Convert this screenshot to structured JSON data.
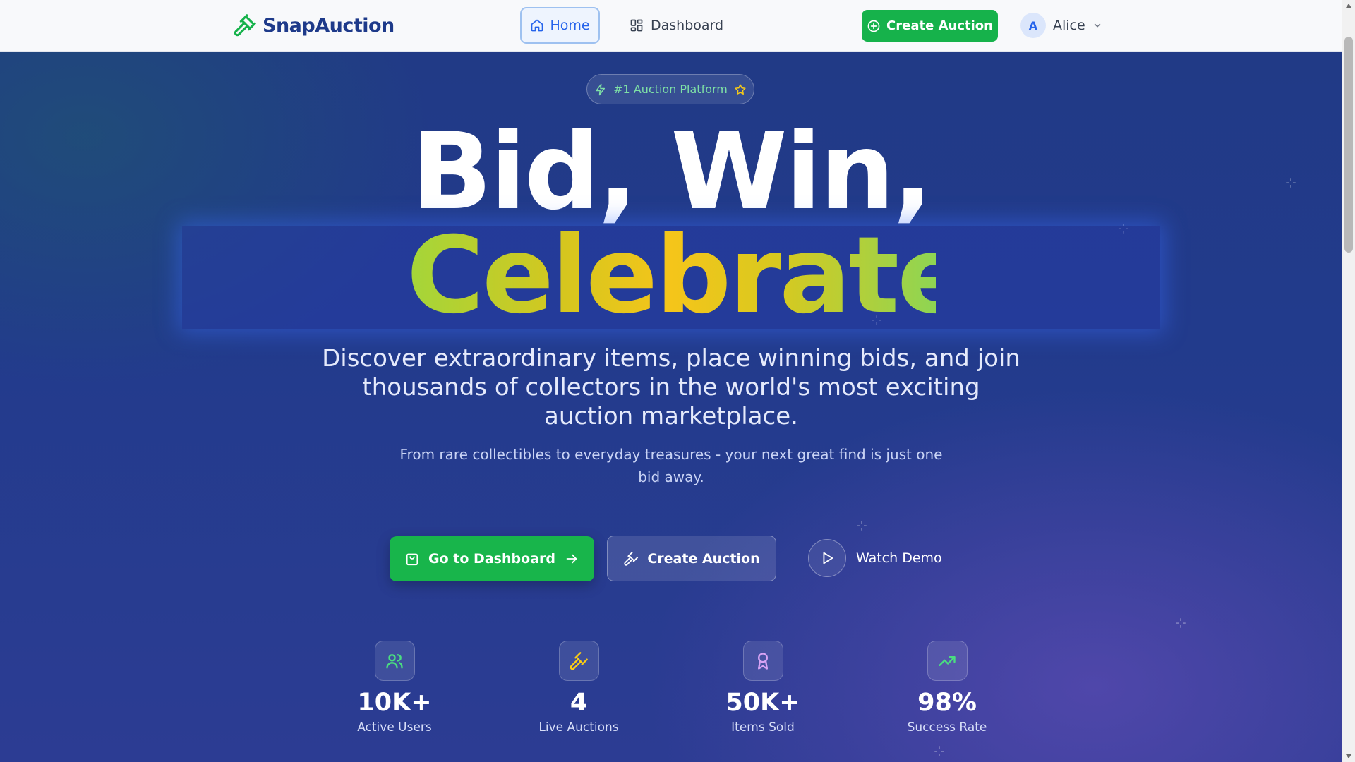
{
  "nav": {
    "brand": "SnapAuction",
    "home_label": "Home",
    "dashboard_label": "Dashboard",
    "create_label": "Create Auction",
    "user_initial": "A",
    "user_name": "Alice"
  },
  "hero": {
    "badge": "#1 Auction Platform",
    "headline_line1": "Bid, Win,",
    "headline_line2": "Celebrate",
    "subtitle": "Discover extraordinary items, place winning bids, and join thousands of collectors in the world's most exciting auction marketplace.",
    "tagline": "From rare collectibles to everyday treasures - your next great find is just one bid away.",
    "buttons": {
      "dashboard": "Go to Dashboard",
      "create": "Create Auction",
      "demo": "Watch Demo"
    }
  },
  "stats": [
    {
      "value": "10K+",
      "label": "Active Users",
      "icon": "users-icon"
    },
    {
      "value": "4",
      "label": "Live Auctions",
      "icon": "gavel-icon"
    },
    {
      "value": "50K+",
      "label": "Items Sold",
      "icon": "award-icon"
    },
    {
      "value": "98%",
      "label": "Success Rate",
      "icon": "trending-up-icon"
    }
  ],
  "colors": {
    "brand_navy": "#1e3a8a",
    "accent_green": "#16b24b",
    "link_blue": "#2563eb",
    "hero_bg": "#223b8c",
    "headline_gold": "#f5c51a"
  }
}
